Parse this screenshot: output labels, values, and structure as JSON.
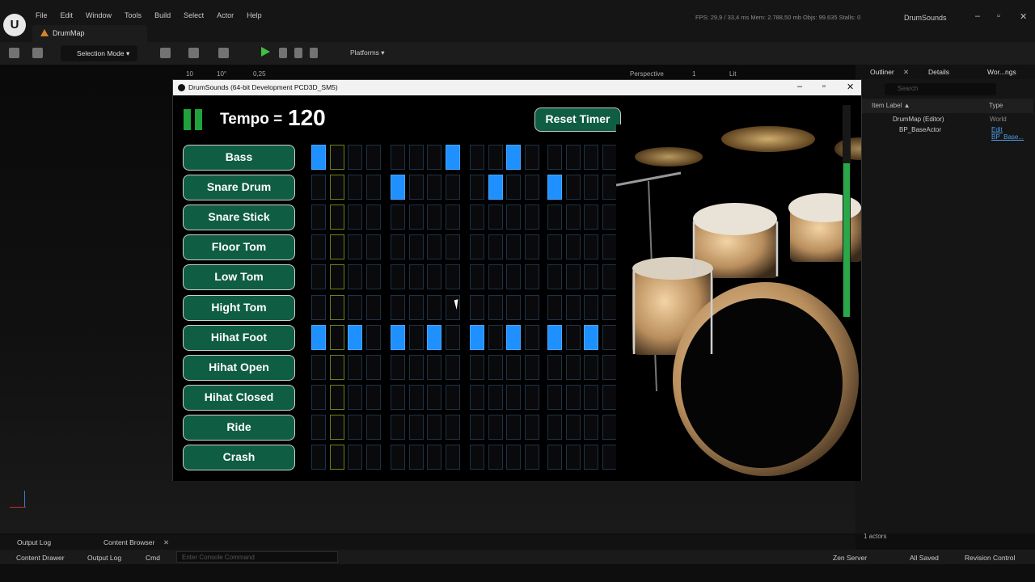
{
  "editor": {
    "menu": [
      "File",
      "Edit",
      "Window",
      "Tools",
      "Build",
      "Select",
      "Actor",
      "Help"
    ],
    "map_tab": "DrumMap",
    "stats": "FPS: 29,9  /  33,4 ms   Mem: 2.788,50 mb   Objs: 99.635   Stalls: 0",
    "project_name": "DrumSounds",
    "selection_mode": "Selection Mode",
    "platforms": "Platforms",
    "viewport": {
      "grid_snap": "10",
      "rot_snap": "10°",
      "scale_snap": "0,25",
      "view_mode": "Perspective",
      "lit": "Lit",
      "cam_speed": "1"
    }
  },
  "outliner": {
    "tab_outliner": "Outliner",
    "tab_details": "Details",
    "tab_world": "Wor...ngs",
    "search_placeholder": "Search",
    "col_label": "Item Label ▲",
    "col_type": "Type",
    "rows": [
      {
        "label": "DrumMap (Editor)",
        "type": "World"
      },
      {
        "label": "BP_BaseActor",
        "type": "Edit BP_Base..."
      }
    ],
    "actor_count": "1 actors"
  },
  "bottom": {
    "tab_output_log": "Output Log",
    "tab_content_browser": "Content Browser",
    "content_drawer": "Content Drawer",
    "output_log": "Output Log",
    "cmd": "Cmd",
    "console_placeholder": "Enter Console Command",
    "zen_server": "Zen Server",
    "all_saved": "All Saved",
    "revision_control": "Revision Control"
  },
  "game": {
    "window_title": "DrumSounds (64-bit Development PCD3D_SM5)",
    "tempo_label": "Tempo =",
    "tempo_value": "120",
    "reset_button": "Reset Timer",
    "current_step": 2,
    "instruments": [
      {
        "name": "Bass",
        "steps": [
          1,
          0,
          0,
          0,
          0,
          0,
          0,
          1,
          0,
          0,
          1,
          0,
          0,
          0,
          0,
          0
        ]
      },
      {
        "name": "Snare Drum",
        "steps": [
          0,
          0,
          0,
          0,
          1,
          0,
          0,
          0,
          0,
          1,
          0,
          0,
          1,
          0,
          0,
          0
        ]
      },
      {
        "name": "Snare Stick",
        "steps": [
          0,
          0,
          0,
          0,
          0,
          0,
          0,
          0,
          0,
          0,
          0,
          0,
          0,
          0,
          0,
          0
        ]
      },
      {
        "name": "Floor Tom",
        "steps": [
          0,
          0,
          0,
          0,
          0,
          0,
          0,
          0,
          0,
          0,
          0,
          0,
          0,
          0,
          0,
          0
        ]
      },
      {
        "name": "Low Tom",
        "steps": [
          0,
          0,
          0,
          0,
          0,
          0,
          0,
          0,
          0,
          0,
          0,
          0,
          0,
          0,
          0,
          0
        ]
      },
      {
        "name": "Hight Tom",
        "steps": [
          0,
          0,
          0,
          0,
          0,
          0,
          0,
          0,
          0,
          0,
          0,
          0,
          0,
          0,
          0,
          0
        ]
      },
      {
        "name": "Hihat Foot",
        "steps": [
          1,
          0,
          1,
          0,
          1,
          0,
          1,
          0,
          1,
          0,
          1,
          0,
          1,
          0,
          1,
          0
        ]
      },
      {
        "name": "Hihat Open",
        "steps": [
          0,
          0,
          0,
          0,
          0,
          0,
          0,
          0,
          0,
          0,
          0,
          0,
          0,
          0,
          0,
          0
        ]
      },
      {
        "name": "Hihat Closed",
        "steps": [
          0,
          0,
          0,
          0,
          0,
          0,
          0,
          0,
          0,
          0,
          0,
          0,
          0,
          0,
          0,
          0
        ]
      },
      {
        "name": "Ride",
        "steps": [
          0,
          0,
          0,
          0,
          0,
          0,
          0,
          0,
          0,
          0,
          0,
          0,
          0,
          0,
          0,
          0
        ]
      },
      {
        "name": "Crash",
        "steps": [
          0,
          0,
          0,
          0,
          0,
          0,
          0,
          0,
          0,
          0,
          0,
          0,
          0,
          0,
          0,
          0
        ]
      }
    ]
  },
  "colors": {
    "accent_green": "#0f5d43",
    "step_on": "#1e90ff",
    "playhead": "#6f7f1c",
    "play_green": "#3fbf3f"
  }
}
